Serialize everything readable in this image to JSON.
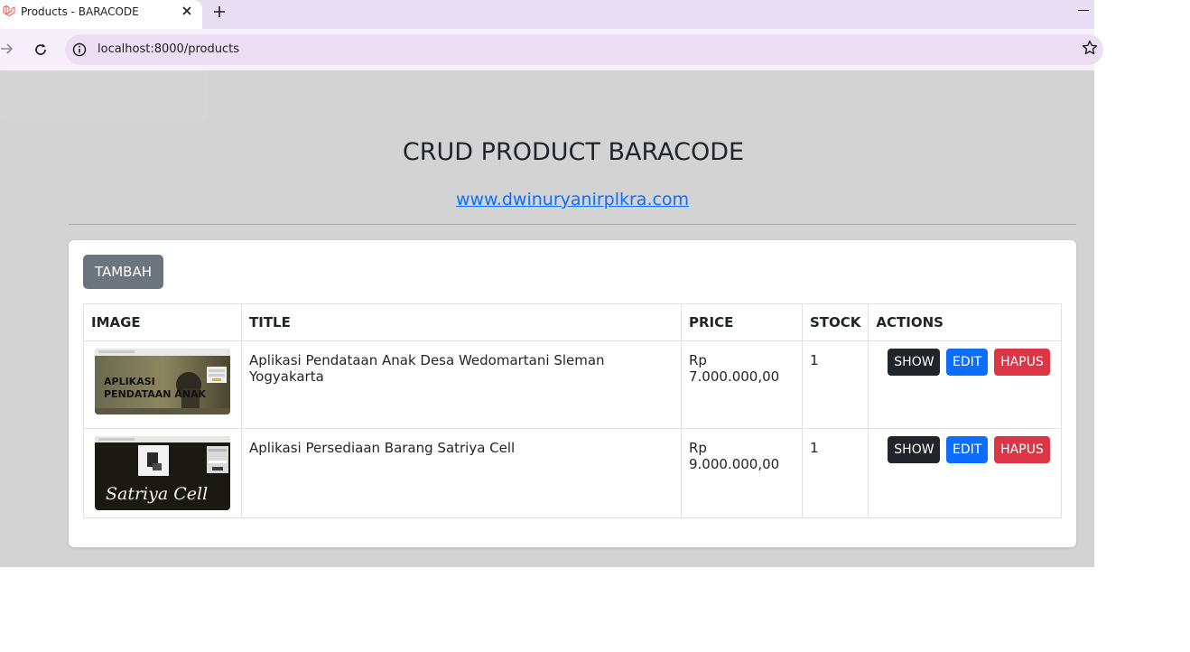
{
  "browser": {
    "tab_title": "Products - BARACODE",
    "url": "localhost:8000/products"
  },
  "page": {
    "title": "CRUD PRODUCT BARACODE",
    "link": "www.dwinuryanirplkra.com",
    "add_button": "TAMBAH"
  },
  "table": {
    "headers": [
      "IMAGE",
      "TITLE",
      "PRICE",
      "STOCK",
      "ACTIONS"
    ],
    "rows": [
      {
        "title": "Aplikasi Pendataan Anak Desa Wedomartani Sleman Yogyakarta",
        "price": "Rp 7.000.000,00",
        "stock": "1",
        "image_text": "APLIKASI PENDATAAN ANAK"
      },
      {
        "title": "Aplikasi Persediaan Barang Satriya Cell",
        "price": "Rp 9.000.000,00",
        "stock": "1",
        "image_text": "Satriya Cell"
      }
    ],
    "actions": {
      "show": "SHOW",
      "edit": "EDIT",
      "delete": "HAPUS"
    }
  },
  "colors": {
    "secondary": "#6c757d",
    "dark": "#212529",
    "primary": "#0d6efd",
    "danger": "#dc3545",
    "background": "#d3d3d3"
  },
  "icons": [
    "laravel-favicon-icon",
    "close-icon",
    "plus-icon",
    "minimize-icon",
    "forward-icon",
    "reload-icon",
    "site-info-icon",
    "star-icon"
  ]
}
